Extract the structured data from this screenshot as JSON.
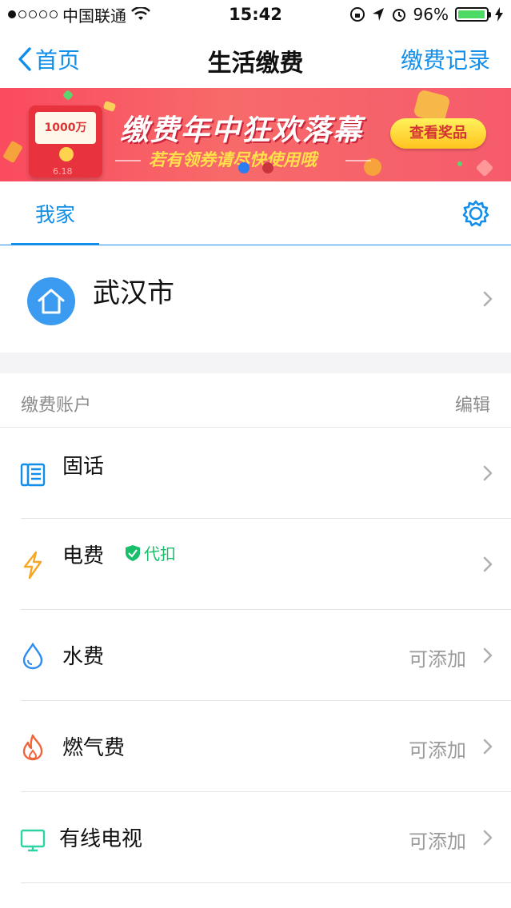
{
  "status_bar": {
    "carrier": "中国联通",
    "time": "15:42",
    "battery_percent": "96%",
    "battery_level": 0.96
  },
  "nav": {
    "back_label": "首页",
    "title": "生活缴费",
    "right_label": "缴费记录"
  },
  "banner": {
    "envelope_amount": "1000万",
    "envelope_date": "6.18",
    "title": "缴费年中狂欢落幕",
    "subtitle": "若有领券请尽快使用哦",
    "cta_label": "查看奖品",
    "pages": 2,
    "active_page": 0
  },
  "tabs": {
    "active_label": "我家"
  },
  "home": {
    "city": "武汉市"
  },
  "accounts": {
    "section_title": "缴费账户",
    "edit_label": "编辑",
    "items": [
      {
        "label": "固话",
        "icon": "phone-card-icon",
        "hint": "",
        "badge": ""
      },
      {
        "label": "电费",
        "icon": "lightning-icon",
        "hint": "",
        "badge": "代扣"
      },
      {
        "label": "水费",
        "icon": "water-drop-icon",
        "hint": "可添加",
        "badge": ""
      },
      {
        "label": "燃气费",
        "icon": "flame-icon",
        "hint": "可添加",
        "badge": ""
      },
      {
        "label": "有线电视",
        "icon": "tv-icon",
        "hint": "可添加",
        "badge": ""
      }
    ]
  },
  "colors": {
    "accent": "#108ee9",
    "badge_green": "#19be6b",
    "home_avatar": "#3b9bf0"
  }
}
